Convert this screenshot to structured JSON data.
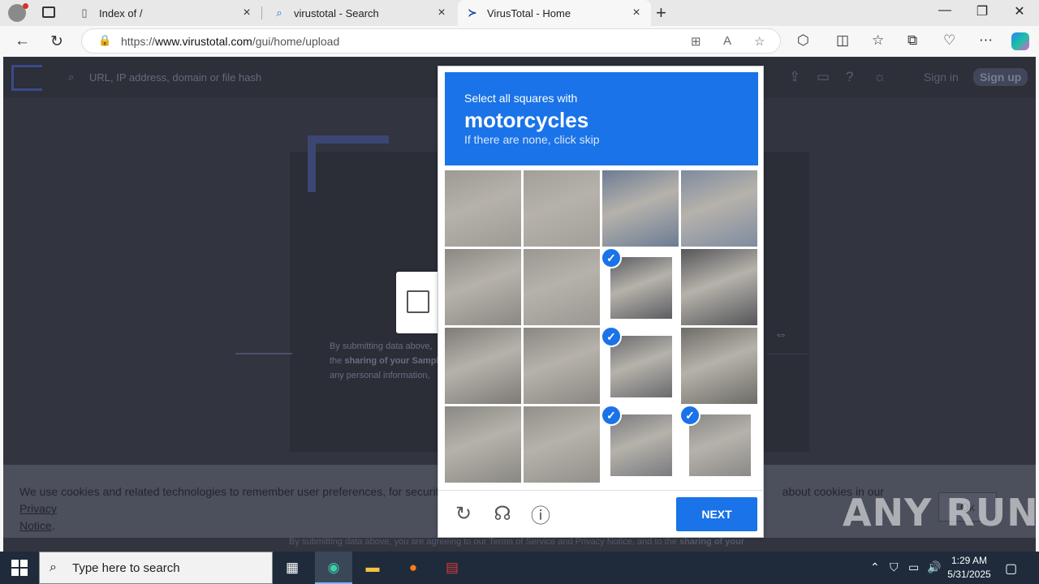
{
  "browser": {
    "tabs": [
      {
        "label": "Index of /",
        "icon": "page-icon"
      },
      {
        "label": "virustotal - Search",
        "icon": "search-icon"
      },
      {
        "label": "VirusTotal - Home",
        "icon": "virustotal-icon",
        "active": true
      }
    ],
    "url_prefix": "https://",
    "url_host": "www.virustotal.com",
    "url_path": "/gui/home/upload"
  },
  "vt": {
    "search_placeholder": "URL, IP address, domain or file hash",
    "signin": "Sign in",
    "signup": "Sign up",
    "submit_text": "By submitting data above, you are agreeing to our Terms of Service and Privacy Notice, and to the sharing of your Sample submission with the security community. Please do not submit any personal information;",
    "submit_line1": "By submitting data above,",
    "submit_line2_a": "the ",
    "submit_line2_b": "sharing of your Sampl",
    "submit_line3": "any personal information,",
    "cookie_text_a": "We use cookies and related technologies to remember user preferences, for security, to",
    "cookie_text_b": "about cookies in our",
    "cookie_link_a": "Privacy",
    "cookie_link_b": "Notice",
    "cookie_ok": "Ok",
    "footer_a": "By submitting data above, you are agreeing to our ",
    "footer_tos": "Terms of Service",
    "footer_and": " and ",
    "footer_pn": "Privacy Notice",
    "footer_b": ", and to the ",
    "footer_share": "sharing of your"
  },
  "captcha": {
    "lead": "Select all squares with",
    "object": "motorcycles",
    "hint": "If there are none, click skip",
    "next": "NEXT",
    "tiles": [
      {
        "selected": false,
        "color": "#9d9a94"
      },
      {
        "selected": false,
        "color": "#a29f99"
      },
      {
        "selected": false,
        "color": "#6c7c94"
      },
      {
        "selected": false,
        "color": "#7f8ba0"
      },
      {
        "selected": false,
        "color": "#8b8883"
      },
      {
        "selected": false,
        "color": "#9a9792"
      },
      {
        "selected": true,
        "color": "#5c5d62"
      },
      {
        "selected": false,
        "color": "#55565a"
      },
      {
        "selected": false,
        "color": "#7e7b77"
      },
      {
        "selected": false,
        "color": "#8a8782"
      },
      {
        "selected": true,
        "color": "#6a6b6e"
      },
      {
        "selected": false,
        "color": "#6d6c66"
      },
      {
        "selected": false,
        "color": "#8a8883"
      },
      {
        "selected": false,
        "color": "#928f8a"
      },
      {
        "selected": true,
        "color": "#7a7b7f"
      },
      {
        "selected": true,
        "color": "#8a8987"
      }
    ]
  },
  "watermark": "ANY RUN",
  "taskbar": {
    "search_placeholder": "Type here to search",
    "time": "1:29 AM",
    "date": "5/31/2025"
  }
}
